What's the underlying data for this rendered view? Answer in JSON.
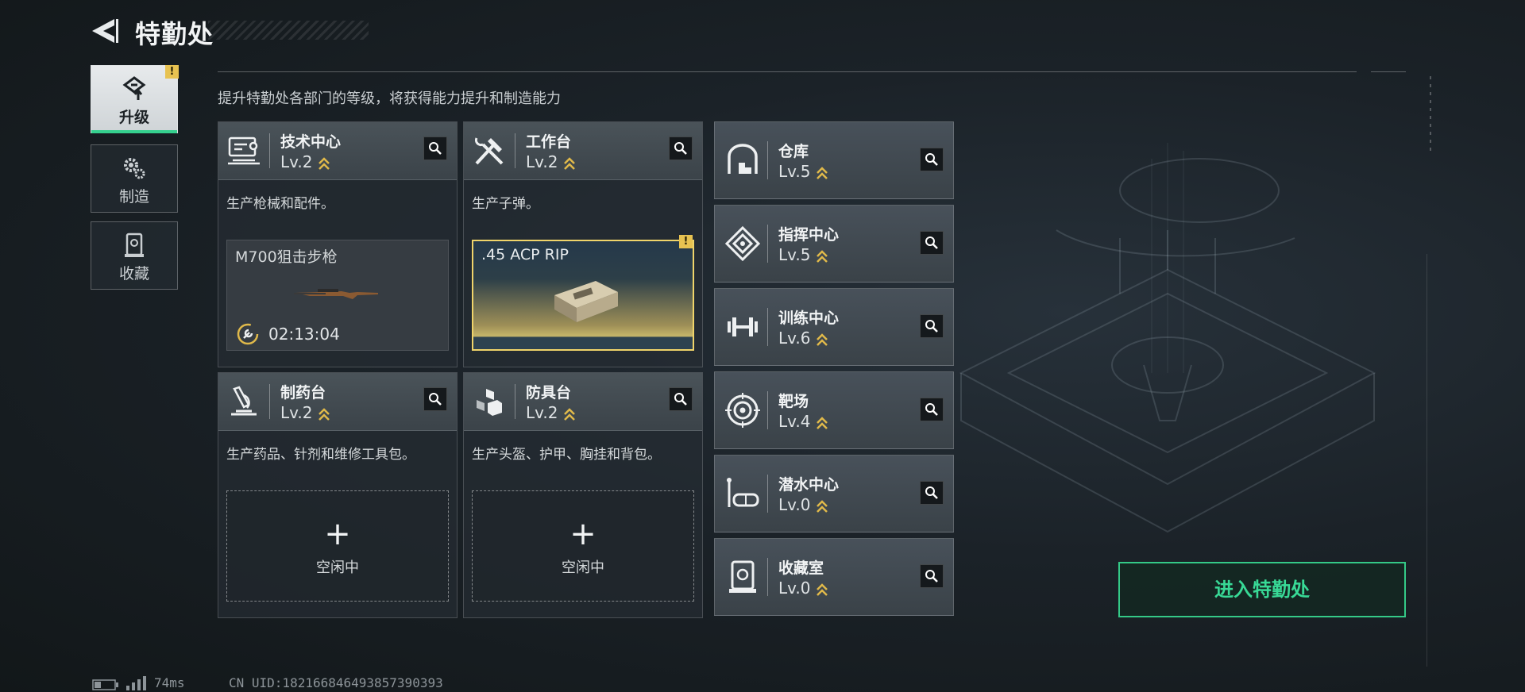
{
  "header": {
    "title": "特勤处"
  },
  "nav": [
    {
      "label": "升级",
      "icon": "upgrade-icon",
      "active": true,
      "badge": "!"
    },
    {
      "label": "制造",
      "icon": "gears-icon",
      "active": false
    },
    {
      "label": "收藏",
      "icon": "collection-icon",
      "active": false
    }
  ],
  "subtitle": "提升特勤处各部门的等级，将获得能力提升和制造能力",
  "cards": [
    {
      "name": "技术中心",
      "level": "Lv.2",
      "desc": "生产枪械和配件。",
      "icon": "tech-center-icon",
      "slot": {
        "item": "M700狙击步枪",
        "timer": "02:13:04"
      }
    },
    {
      "name": "工作台",
      "level": "Lv.2",
      "desc": "生产子弹。",
      "icon": "workbench-icon",
      "slot": {
        "item": ".45 ACP RIP",
        "badge": "!"
      }
    },
    {
      "name": "制药台",
      "level": "Lv.2",
      "desc": "生产药品、针剂和维修工具包。",
      "icon": "pharmacy-icon",
      "slot": {
        "plus": "+",
        "status": "空闲中"
      }
    },
    {
      "name": "防具台",
      "level": "Lv.2",
      "desc": "生产头盔、护甲、胸挂和背包。",
      "icon": "armor-bench-icon",
      "slot": {
        "plus": "+",
        "status": "空闲中"
      }
    }
  ],
  "facilities": [
    {
      "name": "仓库",
      "level": "Lv.5",
      "icon": "warehouse-icon"
    },
    {
      "name": "指挥中心",
      "level": "Lv.5",
      "icon": "command-center-icon"
    },
    {
      "name": "训练中心",
      "level": "Lv.6",
      "icon": "training-center-icon"
    },
    {
      "name": "靶场",
      "level": "Lv.4",
      "icon": "target-range-icon"
    },
    {
      "name": "潜水中心",
      "level": "Lv.0",
      "icon": "diving-center-icon"
    },
    {
      "name": "收藏室",
      "level": "Lv.0",
      "icon": "collection-room-icon"
    }
  ],
  "enter_button": "进入特勤处",
  "footer": {
    "ping": "74ms",
    "uid": "CN UID:182166846493857390393"
  },
  "colors": {
    "accent": "#35d08e",
    "warning": "#e7c251",
    "level_chevron": "#e0b94a"
  }
}
